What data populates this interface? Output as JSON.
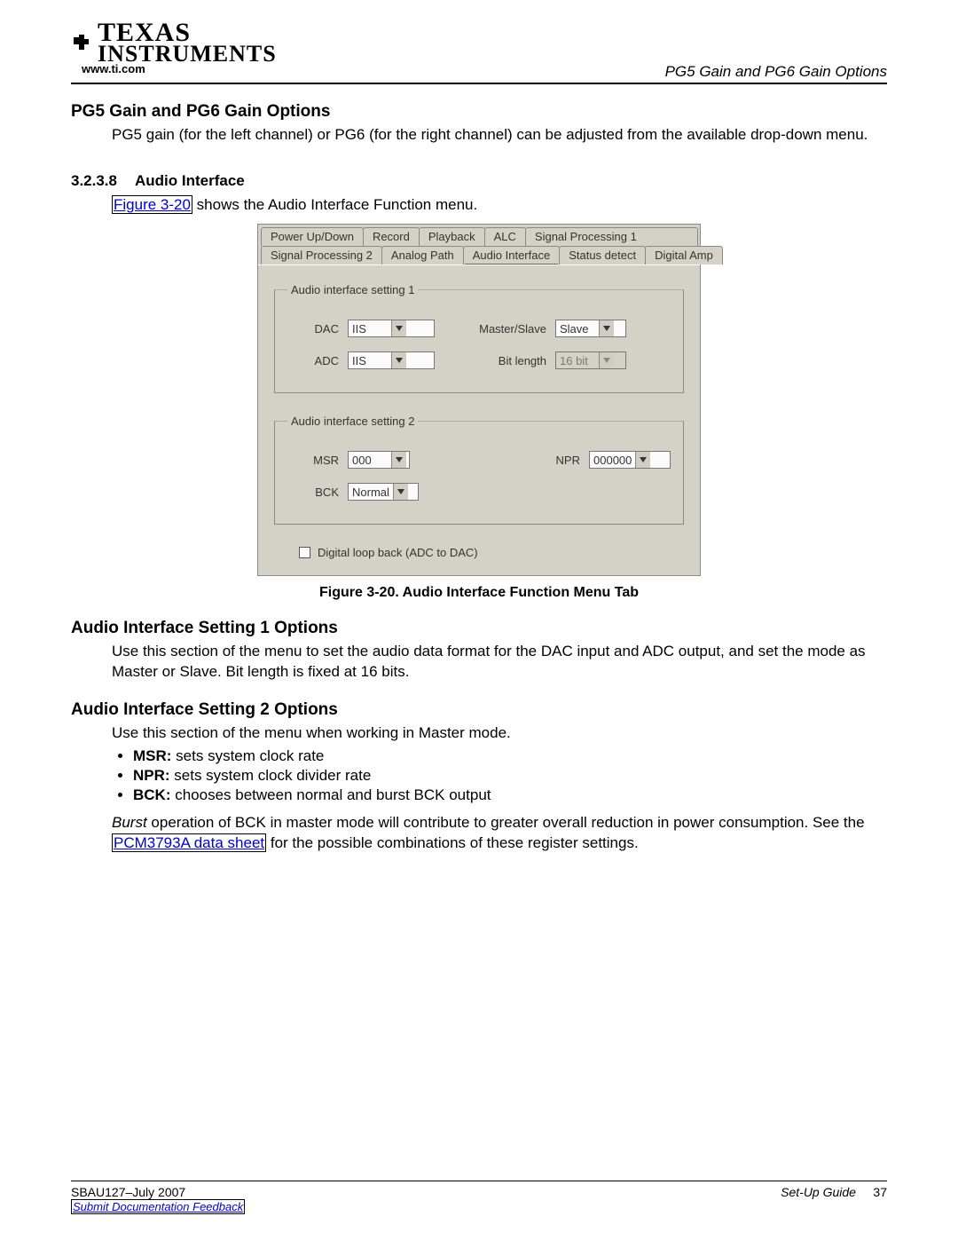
{
  "header": {
    "brand_top": "TEXAS",
    "brand_bottom": "INSTRUMENTS",
    "url": "www.ti.com",
    "breadcrumb": "PG5 Gain and PG6 Gain Options"
  },
  "section1": {
    "title": "PG5 Gain and PG6 Gain Options",
    "body": "PG5 gain (for the left channel) or PG6 (for the right channel) can be adjusted from the available drop-down menu."
  },
  "section2": {
    "number": "3.2.3.8",
    "title": "Audio Interface",
    "lead_prefix": "Figure 3-20",
    "lead_suffix": " shows the Audio Interface Function menu."
  },
  "screenshot": {
    "tabs_row1": [
      "Power Up/Down",
      "Record",
      "Playback",
      "ALC",
      "Signal Processing 1"
    ],
    "tabs_row2": [
      "Signal Processing 2",
      "Analog Path",
      "Audio Interface",
      "Status detect",
      "Digital Amp"
    ],
    "active_tab": "Audio Interface",
    "group1": {
      "legend": "Audio interface setting 1",
      "dac_label": "DAC",
      "dac_value": "IIS",
      "ms_label": "Master/Slave",
      "ms_value": "Slave",
      "adc_label": "ADC",
      "adc_value": "IIS",
      "bl_label": "Bit length",
      "bl_value": "16 bit"
    },
    "group2": {
      "legend": "Audio interface setting 2",
      "msr_label": "MSR",
      "msr_value": "000",
      "npr_label": "NPR",
      "npr_value": "000000",
      "bck_label": "BCK",
      "bck_value": "Normal"
    },
    "checkbox_label": "Digital loop back (ADC to DAC)"
  },
  "figure_caption": "Figure 3-20. Audio Interface Function Menu Tab",
  "section3": {
    "title": "Audio Interface Setting 1 Options",
    "body": "Use this section of the menu to set the audio data format for the DAC input and ADC output, and set the mode as Master or Slave. Bit length is fixed at 16 bits."
  },
  "section4": {
    "title": "Audio Interface Setting 2 Options",
    "intro": "Use this section of the menu when working in Master mode.",
    "items": [
      {
        "term": "MSR:",
        "desc": " sets system clock rate"
      },
      {
        "term": "NPR:",
        "desc": " sets system clock divider rate"
      },
      {
        "term": "BCK:",
        "desc": " chooses between normal and burst BCK output"
      }
    ],
    "burst_sentence_prefix": "Burst",
    "burst_sentence_rest": " operation of BCK in master mode will contribute to greater overall reduction in power consumption. See the ",
    "datasheet_link": "PCM3793A data sheet",
    "burst_sentence_tail": " for the possible combinations of these register settings."
  },
  "footer": {
    "doc_id": "SBAU127–July 2007",
    "feedback": "Submit Documentation Feedback",
    "guide": "Set-Up Guide",
    "page": "37"
  }
}
